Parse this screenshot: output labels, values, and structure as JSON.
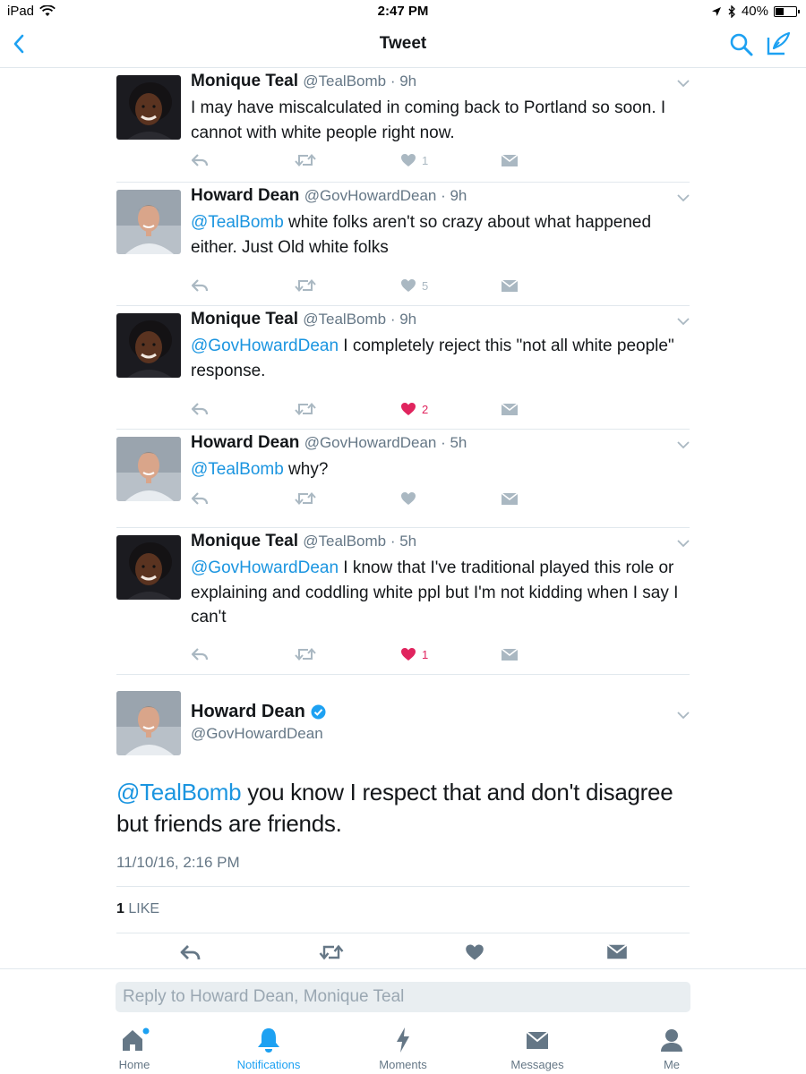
{
  "status_bar": {
    "device": "iPad",
    "time": "2:47 PM",
    "battery": "40%",
    "battery_level": 0.4
  },
  "nav": {
    "title": "Tweet"
  },
  "tweets": [
    {
      "name": "Monique Teal",
      "handle": "@TealBomb",
      "time": "· 9h",
      "mention": "",
      "text": "I may have miscalculated in coming back to Portland so soon. I cannot with white people right now.",
      "like_count": "1",
      "liked": false
    },
    {
      "name": "Howard Dean",
      "handle": "@GovHowardDean",
      "time": "· 9h",
      "mention": "@TealBomb",
      "text": " white folks aren't so crazy about what happened either. Just Old white folks",
      "like_count": "5",
      "liked": false
    },
    {
      "name": "Monique Teal",
      "handle": "@TealBomb",
      "time": "· 9h",
      "mention": "@GovHowardDean",
      "text": " I completely reject this \"not all white people\" response.",
      "like_count": "2",
      "liked": true
    },
    {
      "name": "Howard Dean",
      "handle": "@GovHowardDean",
      "time": "· 5h",
      "mention": "@TealBomb",
      "text": " why?",
      "like_count": "",
      "liked": false
    },
    {
      "name": "Monique Teal",
      "handle": "@TealBomb",
      "time": "· 5h",
      "mention": "@GovHowardDean",
      "text": " I know that I've traditional played this role or explaining and coddling white ppl but I'm not kidding when I say I can't",
      "like_count": "1",
      "liked": true
    }
  ],
  "main_tweet": {
    "name": "Howard Dean",
    "verified": true,
    "handle": "@GovHowardDean",
    "mention": "@TealBomb",
    "text": " you know I respect that and don't disagree but friends are friends.",
    "date": "11/10/16, 2:16 PM",
    "like_count": "1",
    "like_label": "LIKE"
  },
  "reply": {
    "placeholder": "Reply to Howard Dean, Monique Teal"
  },
  "tabs": [
    {
      "label": "Home",
      "icon": "home-icon",
      "active": false
    },
    {
      "label": "Notifications",
      "icon": "bell-icon",
      "active": true
    },
    {
      "label": "Moments",
      "icon": "lightning-icon",
      "active": false
    },
    {
      "label": "Messages",
      "icon": "envelope-icon",
      "active": false
    },
    {
      "label": "Me",
      "icon": "person-icon",
      "active": false
    }
  ],
  "colors": {
    "link": "#1b95e0",
    "like": "#e0245e",
    "muted": "#aab8c2",
    "tab_active": "#1da1f2"
  }
}
